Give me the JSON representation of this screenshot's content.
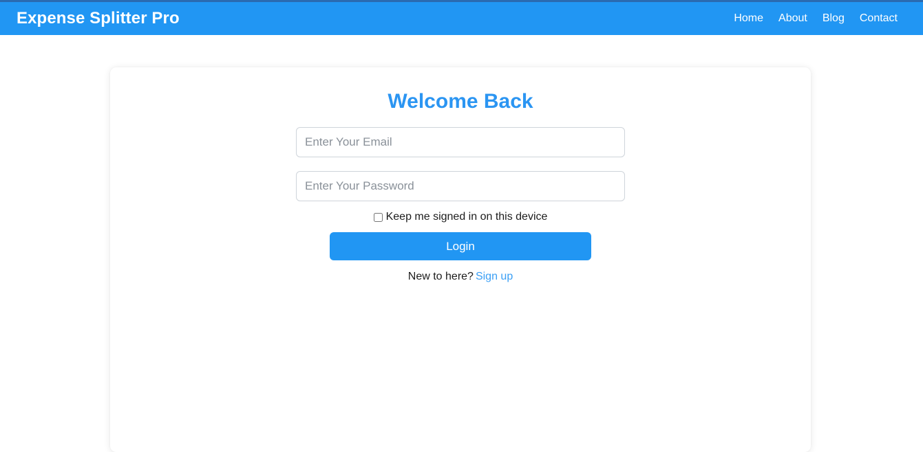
{
  "navbar": {
    "brand": "Expense Splitter Pro",
    "brand_color": "#ffffff",
    "background_color": "#2196f3",
    "links": [
      {
        "label": "Home"
      },
      {
        "label": "About"
      },
      {
        "label": "Blog"
      },
      {
        "label": "Contact"
      }
    ]
  },
  "login_card": {
    "title": "Welcome Back",
    "title_color": "#2b95f2",
    "email_field": {
      "placeholder": "Enter Your Email",
      "value": ""
    },
    "password_field": {
      "placeholder": "Enter Your Password",
      "value": ""
    },
    "remember_me": {
      "label": "Keep me signed in on this device",
      "checked": false
    },
    "submit_button": {
      "label": "Login",
      "color": "#2196f3"
    },
    "signup_prompt": {
      "text": "New to here?",
      "link_label": "Sign up",
      "link_color": "#3a9ff5"
    }
  }
}
